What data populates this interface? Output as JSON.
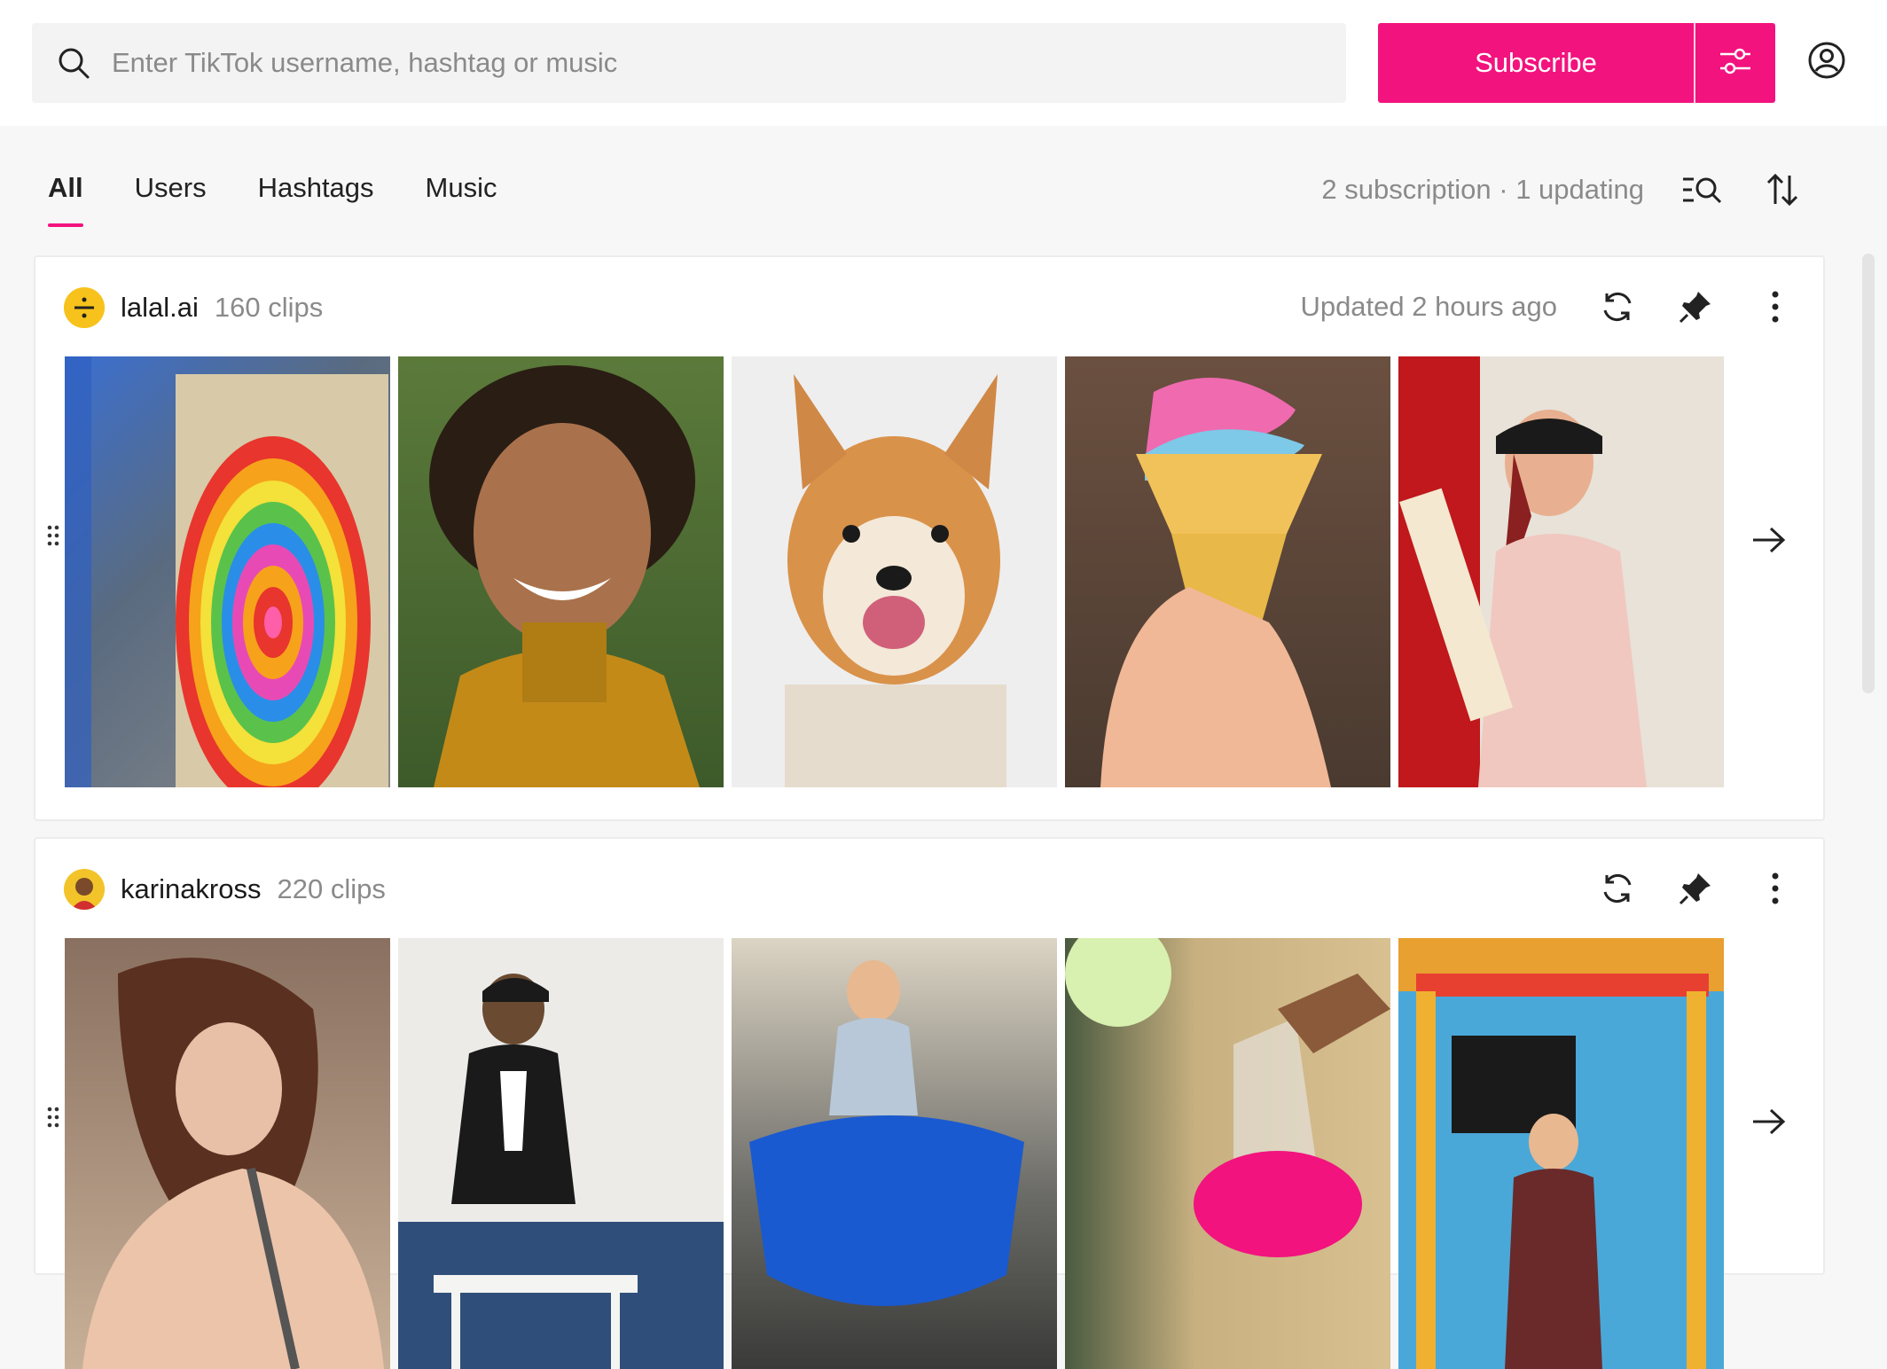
{
  "search": {
    "placeholder": "Enter TikTok username, hashtag or music"
  },
  "subscribe_label": "Subscribe",
  "tabs": [
    {
      "label": "All",
      "active": true
    },
    {
      "label": "Users"
    },
    {
      "label": "Hashtags"
    },
    {
      "label": "Music"
    }
  ],
  "status": "2 subscription · 1 updating",
  "icons": {
    "search": "search-icon",
    "filter": "sliders-icon",
    "account": "user-circle-icon",
    "search_list": "list-search-icon",
    "sort": "sort-arrows-icon",
    "refresh": "refresh-icon",
    "pin": "pin-icon",
    "more": "more-vertical-icon",
    "drag": "drag-handle-icon",
    "next": "arrow-right-icon"
  },
  "colors": {
    "accent": "#f2137e",
    "muted": "#8a8a8a"
  },
  "subscriptions": [
    {
      "username": "lalal.ai",
      "clips": "160 clips",
      "updated": "Updated 2 hours ago",
      "thumbnails": [
        "rainbow-paint-spiral",
        "smiling-person-curly-hair",
        "shiba-inu-dog",
        "ice-cream-cone",
        "woman-with-cricket-bat"
      ]
    },
    {
      "username": "karinakross",
      "clips": "220 clips",
      "updated": "",
      "thumbnails": [
        "woman-sitting-pensive",
        "man-at-table",
        "woman-blue-tarp",
        "pink-paint-pour",
        "man-on-stage"
      ]
    }
  ]
}
